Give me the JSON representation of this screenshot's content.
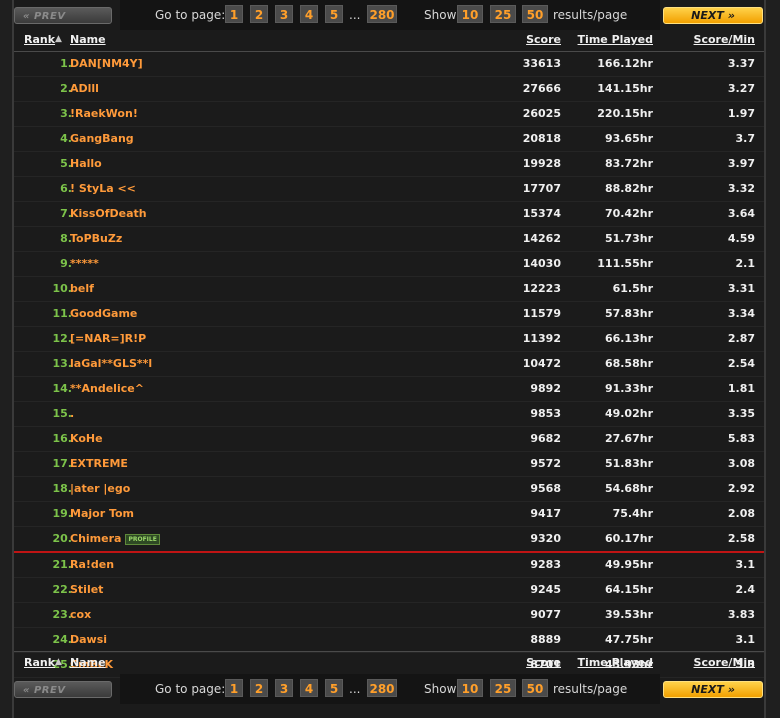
{
  "pager": {
    "prev_label": "« PREV",
    "next_label": "NEXT »",
    "goto_label": "Go to page:",
    "pages": [
      "1",
      "2",
      "3",
      "4",
      "5"
    ],
    "ellipsis": "...",
    "last_page": "280",
    "show_label": "Show",
    "sizes": [
      "10",
      "25",
      "50"
    ],
    "results_label": "results/page"
  },
  "columns": {
    "rank": "Rank",
    "sort_indicator": "▲",
    "name": "Name",
    "score": "Score",
    "time": "Time Played",
    "spm": "Score/Min"
  },
  "rows": [
    {
      "rank": "1.",
      "name": "DAN[NM4Y]",
      "score": "33613",
      "time": "166.12hr",
      "spm": "3.37"
    },
    {
      "rank": "2.",
      "name": "ADlll",
      "score": "27666",
      "time": "141.15hr",
      "spm": "3.27"
    },
    {
      "rank": "3.",
      "name": "!RaekWon!",
      "score": "26025",
      "time": "220.15hr",
      "spm": "1.97"
    },
    {
      "rank": "4.",
      "name": "GangBang",
      "score": "20818",
      "time": "93.65hr",
      "spm": "3.7"
    },
    {
      "rank": "5.",
      "name": "Hallo",
      "score": "19928",
      "time": "83.72hr",
      "spm": "3.97"
    },
    {
      "rank": "6.",
      "name": "! StyLa <<",
      "score": "17707",
      "time": "88.82hr",
      "spm": "3.32"
    },
    {
      "rank": "7.",
      "name": "KissOfDeath",
      "score": "15374",
      "time": "70.42hr",
      "spm": "3.64"
    },
    {
      "rank": "8.",
      "name": "ToPBuZz",
      "score": "14262",
      "time": "51.73hr",
      "spm": "4.59"
    },
    {
      "rank": "9.",
      "name": "*****",
      "score": "14030",
      "time": "111.55hr",
      "spm": "2.1"
    },
    {
      "rank": "10.",
      "name": "belf",
      "score": "12223",
      "time": "61.5hr",
      "spm": "3.31"
    },
    {
      "rank": "11.",
      "name": "GoodGame",
      "score": "11579",
      "time": "57.83hr",
      "spm": "3.34"
    },
    {
      "rank": "12.",
      "name": "[=NAR=]R!P",
      "score": "11392",
      "time": "66.13hr",
      "spm": "2.87"
    },
    {
      "rank": "13.",
      "name": "laGal**GLS**l",
      "score": "10472",
      "time": "68.58hr",
      "spm": "2.54"
    },
    {
      "rank": "14.",
      "name": "**Andelice^",
      "score": "9892",
      "time": "91.33hr",
      "spm": "1.81"
    },
    {
      "rank": "15.",
      "name": ".",
      "score": "9853",
      "time": "49.02hr",
      "spm": "3.35"
    },
    {
      "rank": "16.",
      "name": "KoHe",
      "score": "9682",
      "time": "27.67hr",
      "spm": "5.83"
    },
    {
      "rank": "17.",
      "name": "EXTREME",
      "score": "9572",
      "time": "51.83hr",
      "spm": "3.08"
    },
    {
      "rank": "18.",
      "name": "|ater |ego",
      "score": "9568",
      "time": "54.68hr",
      "spm": "2.92"
    },
    {
      "rank": "19.",
      "name": "Major Tom",
      "score": "9417",
      "time": "75.4hr",
      "spm": "2.08"
    },
    {
      "rank": "20.",
      "name": "Chimera",
      "badge": "PROFILE",
      "score": "9320",
      "time": "60.17hr",
      "spm": "2.58",
      "current_user": true
    },
    {
      "rank": "21.",
      "name": "Ra!den",
      "score": "9283",
      "time": "49.95hr",
      "spm": "3.1"
    },
    {
      "rank": "22.",
      "name": "Stilet",
      "score": "9245",
      "time": "64.15hr",
      "spm": "2.4"
    },
    {
      "rank": "23.",
      "name": "cox",
      "score": "9077",
      "time": "39.53hr",
      "spm": "3.83"
    },
    {
      "rank": "24.",
      "name": "Dawsi",
      "score": "8889",
      "time": "47.75hr",
      "spm": "3.1"
    },
    {
      "rank": "25.",
      "name": "CmBcK",
      "score": "8701",
      "time": "43.93hr",
      "spm": "3.3"
    }
  ],
  "colors": {
    "rank": "#7cc34a",
    "name": "#ff9a3a",
    "highlight_line": "#c01414",
    "next_button": "#f2a000"
  }
}
